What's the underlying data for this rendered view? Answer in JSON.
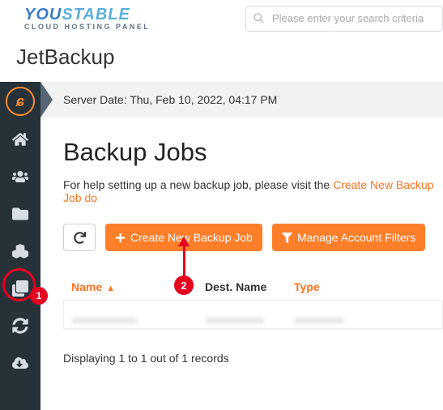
{
  "brand": {
    "you": "YOU",
    "stable": "STABLE",
    "sub": "CLOUD HOSTING PANEL"
  },
  "search": {
    "placeholder": "Please enter your search criteria"
  },
  "page_title": "JetBackup",
  "server_date": "Server Date: Thu, Feb 10, 2022, 04:17 PM",
  "heading": "Backup Jobs",
  "help_prefix": "For help setting up a new backup job, please visit the ",
  "help_link": "Create New Backup Job do",
  "buttons": {
    "create": "Create New Backup Job",
    "manage": "Manage Account Filters"
  },
  "table": {
    "headers": {
      "name": "Name",
      "dest": "Dest. Name",
      "type": "Type"
    }
  },
  "footer": "Displaying 1 to 1 out of 1 records",
  "annotations": {
    "badge1": "1",
    "badge2": "2"
  },
  "colors": {
    "orange": "#ff7e29",
    "linkOrange": "#ff7421",
    "red": "#e6001f",
    "darkSidebar": "#263238"
  }
}
